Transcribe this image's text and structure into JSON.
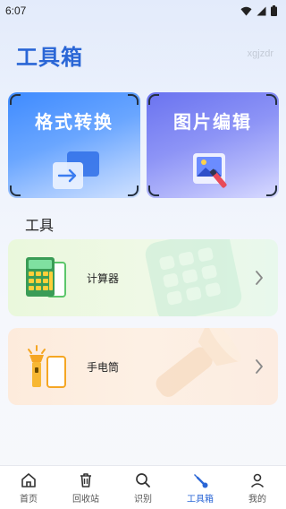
{
  "status_bar": {
    "time": "6:07"
  },
  "header": {
    "title": "工具箱",
    "watermark": "xgjzdr"
  },
  "feature_cards": [
    {
      "label": "格式转换"
    },
    {
      "label": "图片编辑"
    }
  ],
  "tools_section": {
    "title": "工具",
    "items": [
      {
        "label": "计算器",
        "accent": "#5cc66a"
      },
      {
        "label": "手电筒",
        "accent": "#f5a623"
      }
    ]
  },
  "bottom_nav": {
    "active_index": 3,
    "active_color": "#2a66d6",
    "items": [
      {
        "label": "首页",
        "icon": "home-icon"
      },
      {
        "label": "回收站",
        "icon": "trash-icon"
      },
      {
        "label": "识别",
        "icon": "search-icon"
      },
      {
        "label": "工具箱",
        "icon": "wrench-icon"
      },
      {
        "label": "我的",
        "icon": "person-icon"
      }
    ]
  }
}
